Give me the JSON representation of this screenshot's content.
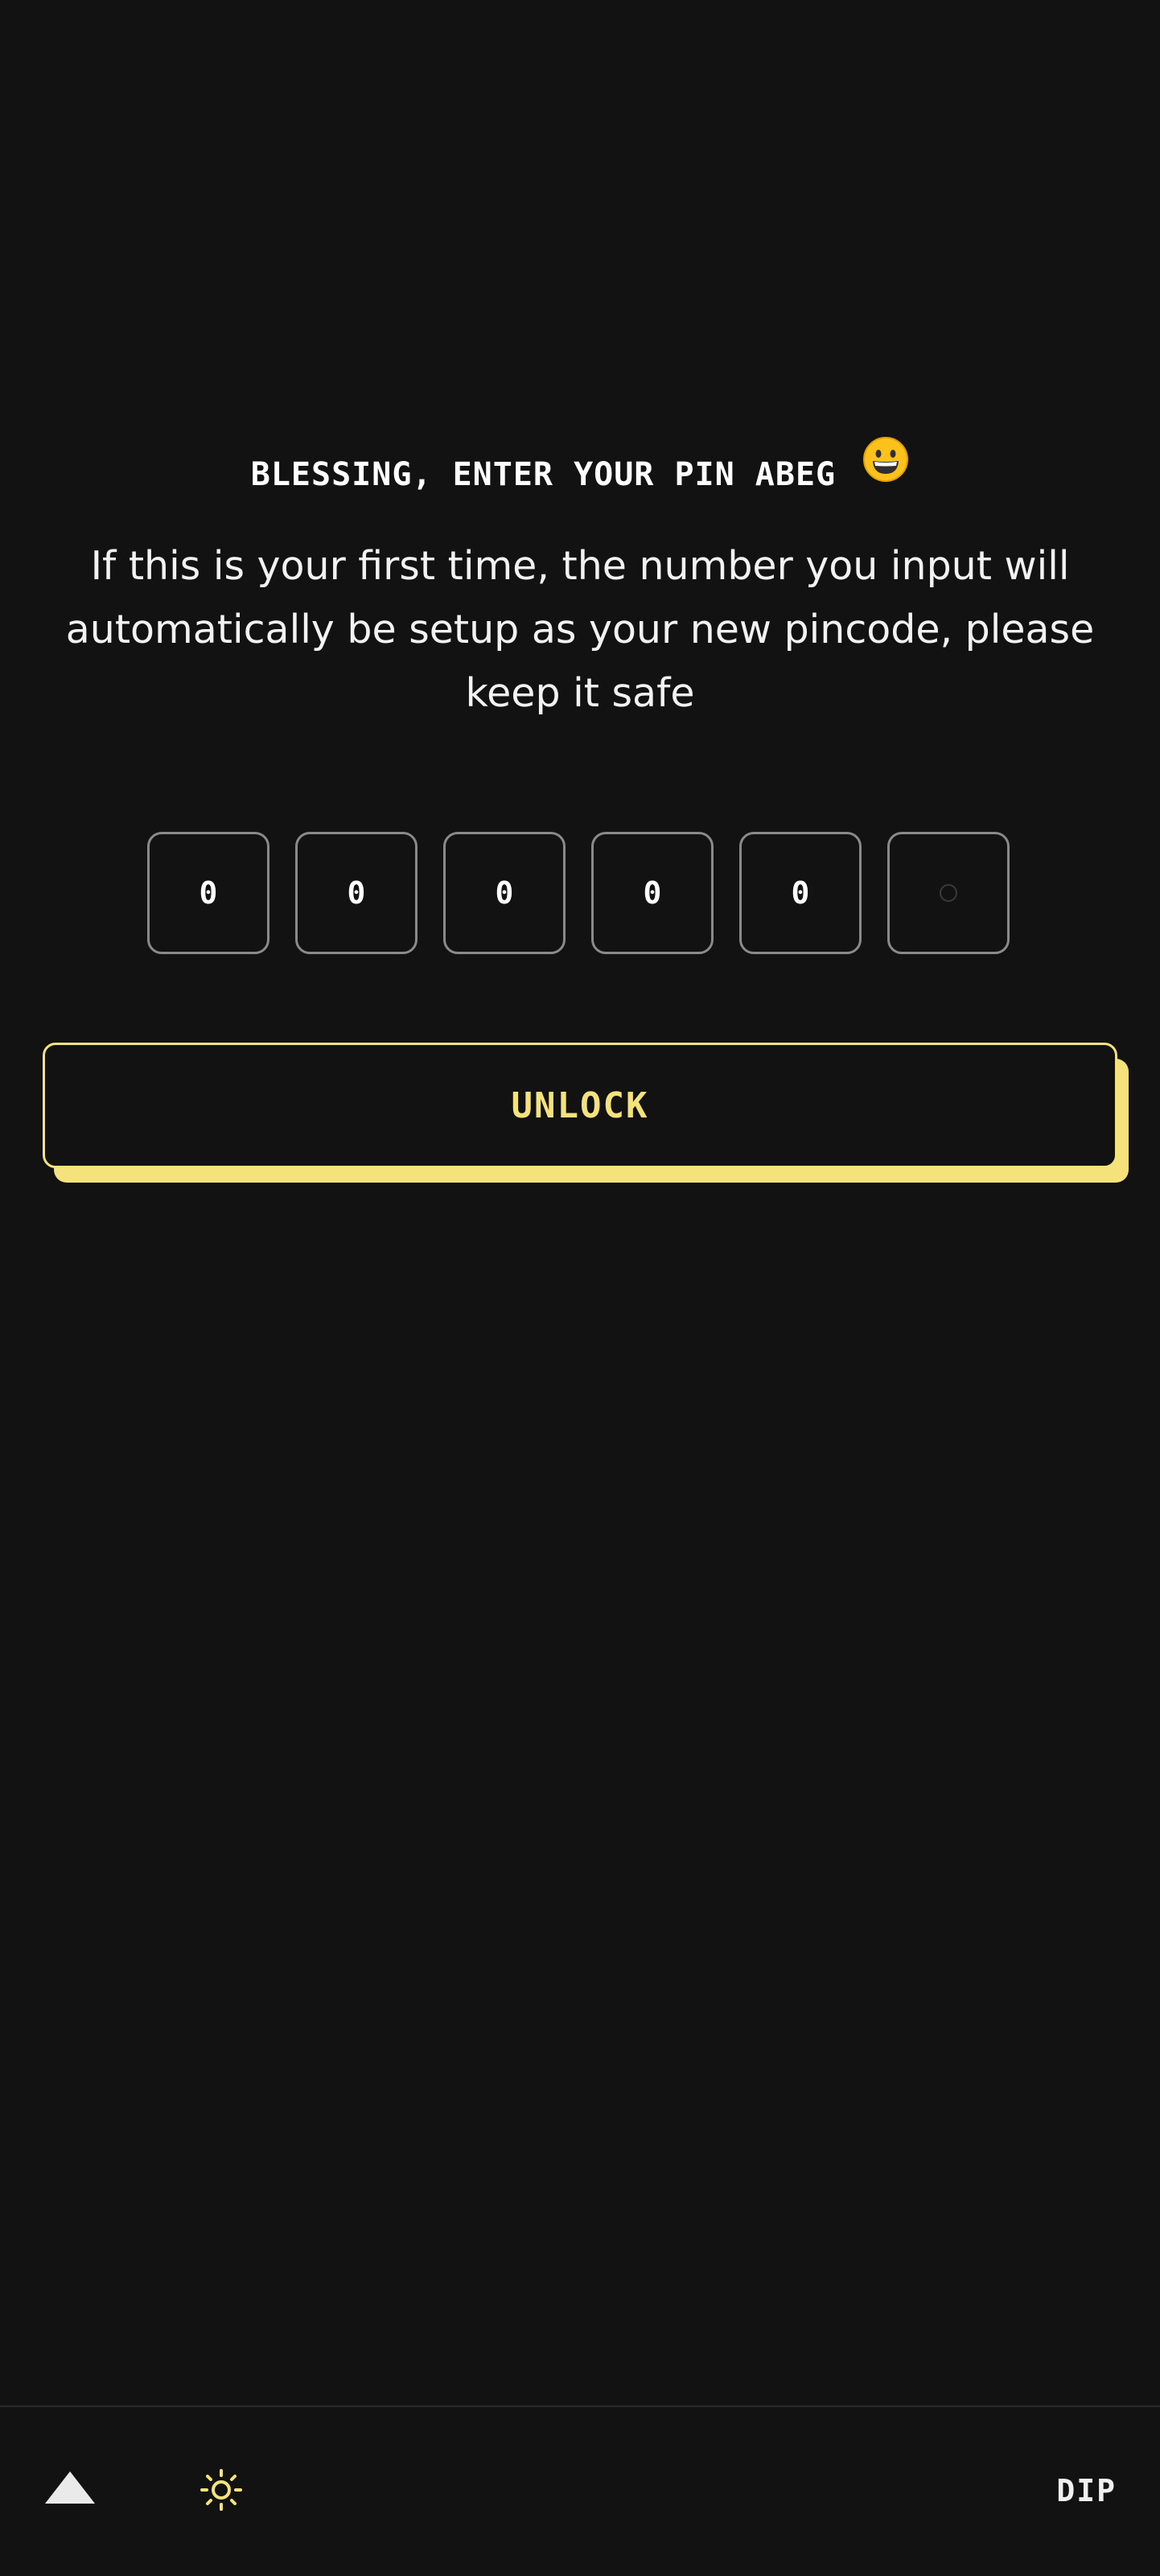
{
  "pin_screen": {
    "heading": "BLESSING, ENTER YOUR PIN ABEG",
    "heading_emoji": "grinning-face",
    "subtext": "If this is your first time, the number you input will automatically be setup as your new pincode, please keep it safe",
    "pin_digits": [
      "0",
      "0",
      "0",
      "0",
      "0",
      ""
    ],
    "unlock_label": "UNLOCK"
  },
  "footer": {
    "logo_icon": "triangle-logo-icon",
    "theme_icon": "sun-icon",
    "right_label": "DIP"
  },
  "colors": {
    "background": "#121212",
    "accent": "#f5e27a",
    "pin_border": "#8a8a8a"
  }
}
